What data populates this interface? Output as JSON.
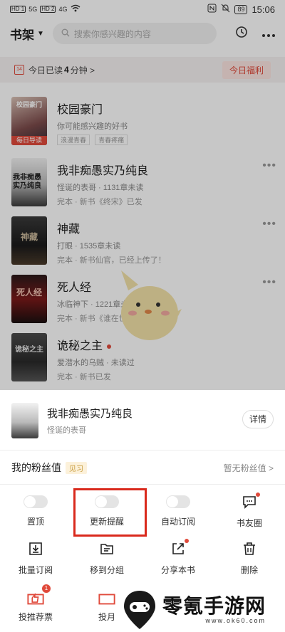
{
  "status_bar": {
    "hd1": "HD 1",
    "hd2": "HD 2",
    "signal1": "5G",
    "signal2": "4G",
    "battery": "89",
    "time": "15:06"
  },
  "header": {
    "title": "书架",
    "search_placeholder": "搜索你感兴趣的内容"
  },
  "reading_banner": {
    "prefix": "今日已读",
    "minutes": "4",
    "suffix": "分钟 >",
    "welfare_button": "今日福利"
  },
  "books": [
    {
      "title": "校园豪门",
      "line1": "你可能感兴趣的好书",
      "tags": [
        "浪漫青春",
        "青春疼痛"
      ],
      "badge": "每日导读",
      "cover_text": "校园豪门"
    },
    {
      "title": "我非痴愚实乃纯良",
      "line1": "怪诞的表哥 · 1131章未读",
      "line2": "完本 · 新书《终宋》已发",
      "cover_text": "我非痴愚实乃纯良"
    },
    {
      "title": "神藏",
      "line1": "打眼 · 1535章未读",
      "line2": "完本 · 新书仙官，已经上传了！",
      "cover_text": "神藏"
    },
    {
      "title": "死人经",
      "line1": "冰临神下 · 1221章未读",
      "line2": "完本 · 新书《谁在世界上发布》",
      "cover_text": "死人经"
    },
    {
      "title": "诡秘之主",
      "line1": "爱潜水的乌贼 · 未读过",
      "line2": "完本 · 新书已发",
      "cover_text": "诡秘之主"
    }
  ],
  "sheet": {
    "book_title": "我非痴愚实乃纯良",
    "book_author": "怪诞的表哥",
    "detail_button": "详情",
    "fans_label": "我的粉丝值",
    "fans_badge": "见习",
    "fans_value": "暂无粉丝值 >",
    "row1": [
      "置顶",
      "更新提醒",
      "自动订阅",
      "书友圈"
    ],
    "row2": [
      "批量订阅",
      "移到分组",
      "分享本书",
      "删除"
    ],
    "row3": [
      "投推荐票",
      "投月"
    ],
    "recommend_count": "1"
  },
  "watermark": {
    "brand": "零氪手游网",
    "url": "www.ok60.com"
  },
  "colors": {
    "accent": "#e04a3b",
    "highlight_box": "#d9291c"
  }
}
